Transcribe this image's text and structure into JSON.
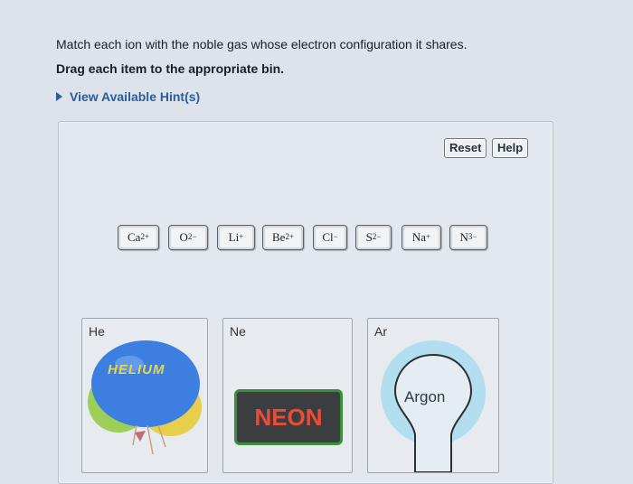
{
  "instructions": {
    "line1": "Match each ion with the noble gas whose electron configuration it shares.",
    "line2": "Drag each item to the appropriate bin."
  },
  "hints": {
    "label": "View Available Hint(s)"
  },
  "toolbar": {
    "reset_label": "Reset",
    "help_label": "Help"
  },
  "ions": [
    {
      "base": "Ca",
      "charge": "2+"
    },
    {
      "base": "O",
      "charge": "2−"
    },
    {
      "base": "Li",
      "charge": "+"
    },
    {
      "base": "Be",
      "charge": "2+"
    },
    {
      "base": "Cl",
      "charge": "−"
    },
    {
      "base": "S",
      "charge": "2−"
    },
    {
      "base": "Na",
      "charge": "+"
    },
    {
      "base": "N",
      "charge": "3−"
    }
  ],
  "bins": [
    {
      "label": "He",
      "image_text": "HELIUM"
    },
    {
      "label": "Ne",
      "image_text": "NEON"
    },
    {
      "label": "Ar",
      "image_text": "Argon"
    }
  ],
  "colors": {
    "hint_link": "#2a5d9a",
    "neon_text": "#ee4b36",
    "neon_border": "#3c8f3a",
    "helium_balloon": "#3d7fe0",
    "argon_glow": "#8fd6f0"
  }
}
